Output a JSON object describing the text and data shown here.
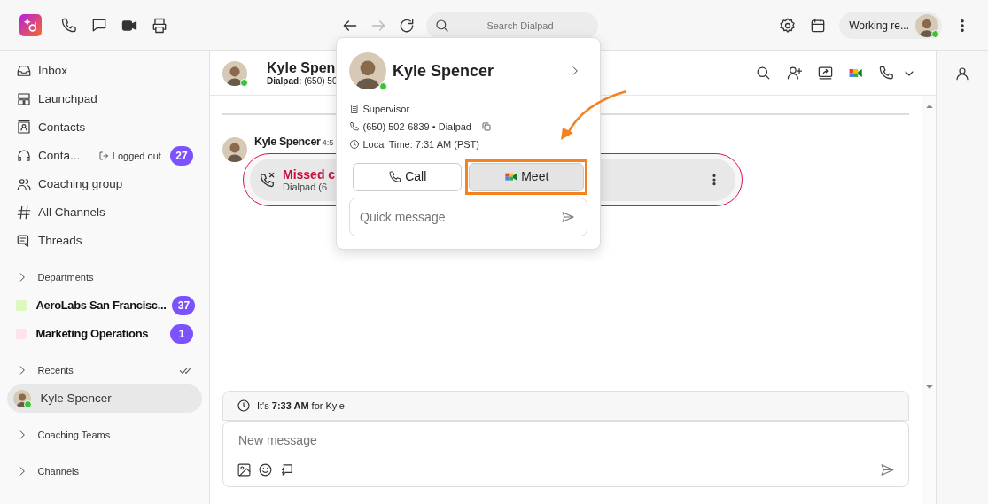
{
  "topbar": {
    "search": {
      "placeholder": "Search Dialpad"
    },
    "forward_disabled": true,
    "status": {
      "label": "Working re...",
      "online": true
    }
  },
  "sidebar": {
    "nav": [
      {
        "label": "Inbox"
      },
      {
        "label": "Launchpad"
      },
      {
        "label": "Contacts"
      },
      {
        "label": "Conta...",
        "status": "Logged out",
        "badge": "27"
      },
      {
        "label": "Coaching group"
      },
      {
        "label": "All Channels"
      },
      {
        "label": "Threads"
      }
    ],
    "sections": [
      {
        "title": "Departments",
        "expanded": false,
        "mark_read": false,
        "items": [
          {
            "label": "AeroLabs San Francisc...",
            "color": "#dcf8bd",
            "badge": "37",
            "unread": true,
            "selected": false
          },
          {
            "label": "Marketing Operations",
            "color": "#fde3f0",
            "badge": "1",
            "unread": true,
            "selected": false
          }
        ]
      },
      {
        "title": "Recents",
        "expanded": false,
        "mark_read": true,
        "items": [
          {
            "label": "Kyle Spencer",
            "online": true,
            "unread": false,
            "selected": true
          }
        ]
      },
      {
        "title": "Coaching Teams",
        "expanded": false,
        "mark_read": false
      },
      {
        "title": "Channels",
        "expanded": false,
        "mark_read": false
      }
    ]
  },
  "chat": {
    "header": {
      "name": "Kyle Spen",
      "line_label": "Dialpad:",
      "line_value": " (650) 50",
      "online": true
    },
    "messages": [
      {
        "sender": "Kyle Spencer",
        "time": "4:5",
        "call_title": "Missed c",
        "call_detail": "Dialpad (6"
      }
    ],
    "time_notice": "It's **7:33 AM** for Kyle.",
    "composer": {
      "placeholder": "New message"
    }
  },
  "popover": {
    "name": "Kyle Spencer",
    "online": true,
    "role": "Supervisor",
    "phone": "(650) 502-6839 • Dialpad",
    "local_time": "Local Time: 7:31 AM (PST)",
    "buttons": [
      {
        "label": "Call",
        "kind": "call",
        "highlighted": false
      },
      {
        "label": "Meet",
        "kind": "meet",
        "highlighted": true
      }
    ],
    "quick_message": {
      "placeholder": "Quick message"
    }
  }
}
